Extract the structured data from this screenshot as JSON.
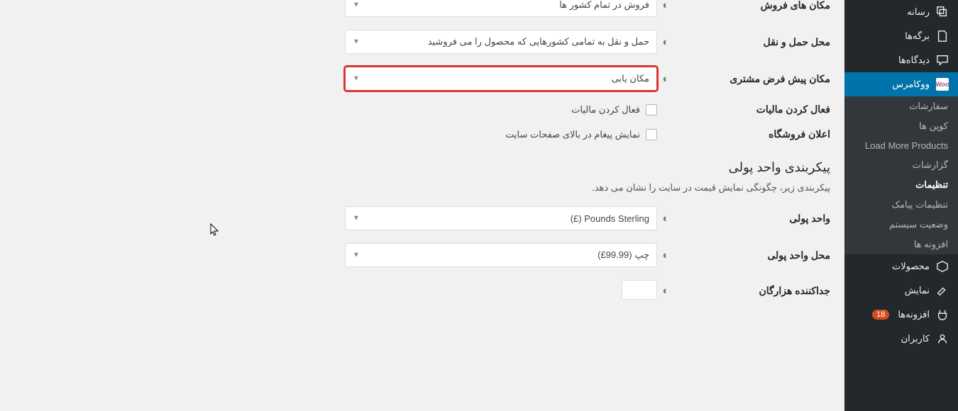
{
  "sidebar": {
    "media": "رسانه",
    "pages": "برگه‌ها",
    "comments": "دیدگاه‌ها",
    "woocommerce": "ووکامرس",
    "sub": {
      "orders": "سفارشات",
      "coupons": "کوپن ها",
      "loadmore": "Load More Products",
      "reports": "گزارشات",
      "settings": "تنظیمات",
      "sms": "تنظیمات پیامک",
      "status": "وضعیت سیستم",
      "addons": "افزونه ها"
    },
    "products": "محصولات",
    "appearance": "نمایش",
    "plugins": "افزونه‌ها",
    "plugins_count": "18",
    "users": "کاربران"
  },
  "form": {
    "selling_loc": {
      "label": "مکان های فروش",
      "value": "فروش در تمام کشور ها"
    },
    "shipping_loc": {
      "label": "محل حمل و نقل",
      "value": "حمل و نقل به تمامی کشورهایی که محصول را می فروشید"
    },
    "customer_loc": {
      "label": "مکان پیش فرض مشتری",
      "value": "مکان یابی"
    },
    "tax": {
      "label": "فعال کردن مالیات",
      "text": "فعال کردن مالیات"
    },
    "notice": {
      "label": "اعلان فروشگاه",
      "text": "نمایش پیغام در بالای صفحات سایت"
    },
    "currency_section": {
      "title": "پیکربندی واحد پولی",
      "desc": "پیکربندی زیر، چگونگی نمایش قیمت در سایت را نشان می دهد."
    },
    "currency": {
      "label": "واحد پولی",
      "value": "(£) Pounds Sterling"
    },
    "currency_pos": {
      "label": "محل واحد پولی",
      "value": "چپ (99.99£)"
    },
    "thousand_sep": {
      "label": "جداکننده هزارگان"
    }
  }
}
